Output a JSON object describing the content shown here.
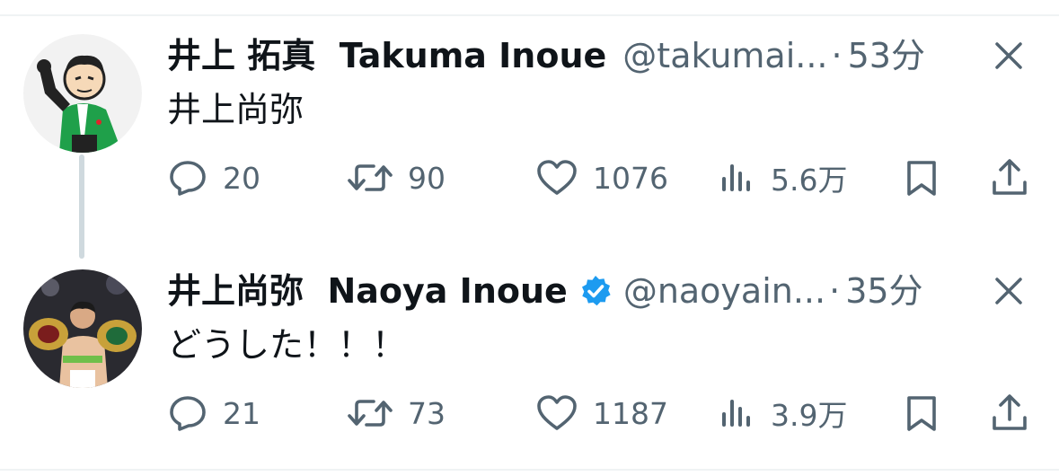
{
  "tweets": [
    {
      "display_name": "井上 拓真",
      "display_name_en": "Takuma Inoue",
      "handle": "@takumai...",
      "separator": "·",
      "time": "53分",
      "text": "井上尚弥",
      "verified": false,
      "stats": {
        "replies": "20",
        "retweets": "90",
        "likes": "1076",
        "views": "5.6万"
      }
    },
    {
      "display_name": "井上尚弥",
      "display_name_en": "Naoya Inoue",
      "handle": "@naoyain...",
      "separator": "·",
      "time": "35分",
      "text": "どうした！！！",
      "verified": true,
      "stats": {
        "replies": "21",
        "retweets": "73",
        "likes": "1187",
        "views": "3.9万"
      }
    }
  ],
  "icons": {
    "reply": "reply-icon",
    "retweet": "retweet-icon",
    "like": "heart-icon",
    "views": "views-icon",
    "bookmark": "bookmark-icon",
    "share": "share-icon",
    "close": "close-icon",
    "verified": "verified-badge-icon"
  },
  "colors": {
    "text_primary": "#0f1419",
    "text_secondary": "#536471",
    "verified_blue": "#1d9bf0",
    "thread_line": "#cfd9de",
    "divider": "#eff3f4"
  }
}
